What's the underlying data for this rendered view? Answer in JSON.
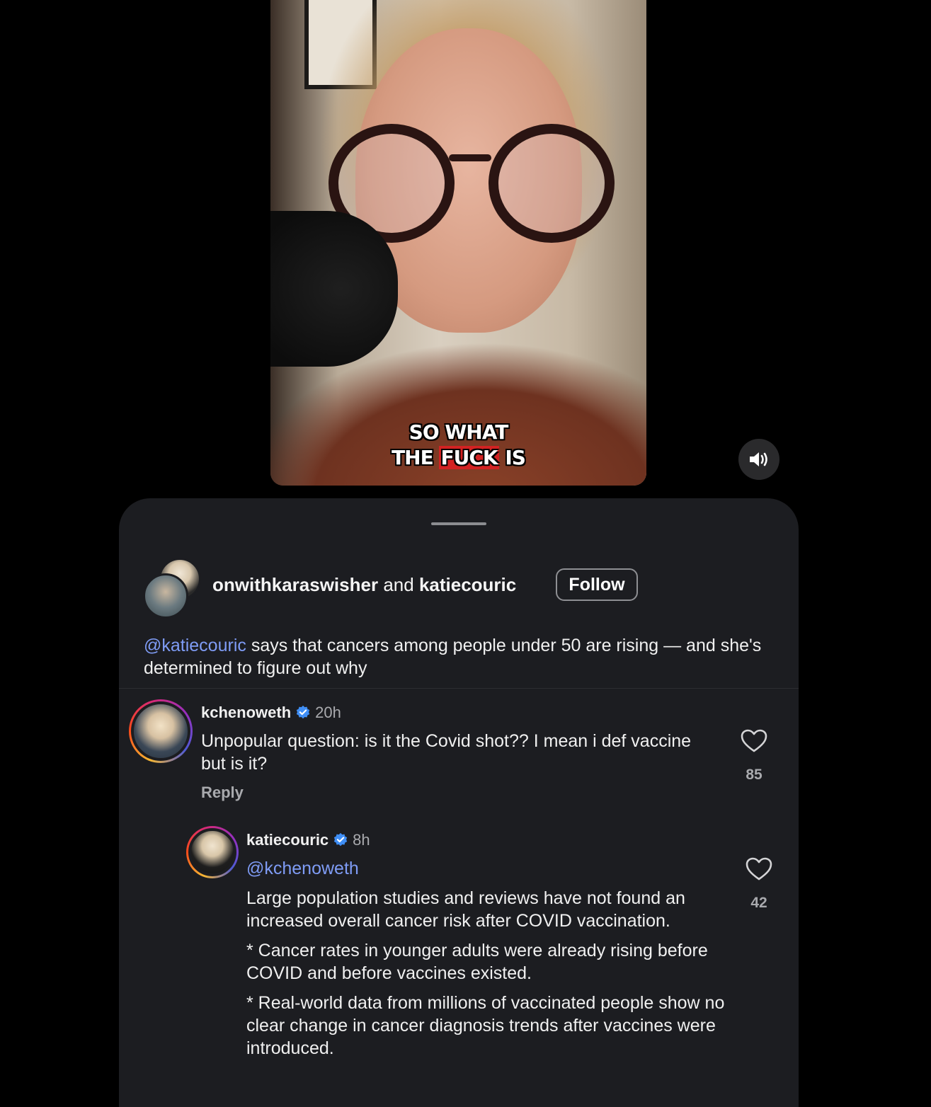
{
  "video": {
    "caption_line1": "SO WHAT",
    "caption_line2_pre": "THE ",
    "caption_line2_highlight": "FUCK",
    "caption_line2_post": " IS",
    "sound_icon": "speaker-on-icon"
  },
  "post": {
    "author1": "onwithkaraswisher",
    "and_text": "and",
    "author2": "katiecouric",
    "follow_label": "Follow",
    "caption_mention": "@katiecouric",
    "caption_text": " says that cancers among people under 50 are rising — and she's determined to figure out why"
  },
  "comments": [
    {
      "username": "kchenoweth",
      "time": "20h",
      "text": "Unpopular question: is it the Covid shot?? I mean i def vaccine but is it?",
      "reply_label": "Reply",
      "likes": "85"
    },
    {
      "username": "katiecouric",
      "time": "8h",
      "mention": "@kchenoweth",
      "paragraphs": [
        "Large population studies and reviews have not found an increased overall cancer risk after COVID vaccination.",
        "* Cancer rates in younger adults were already rising before COVID and before vaccines existed.",
        "* Real-world data from millions of vaccinated people show no clear change in cancer diagnosis trends after vaccines were introduced."
      ],
      "likes": "42"
    }
  ],
  "colors": {
    "background": "#000000",
    "sheet": "#1c1d21",
    "mention": "#7f9cf5",
    "verified": "#3f8ef5",
    "muted": "#a9aaae"
  }
}
